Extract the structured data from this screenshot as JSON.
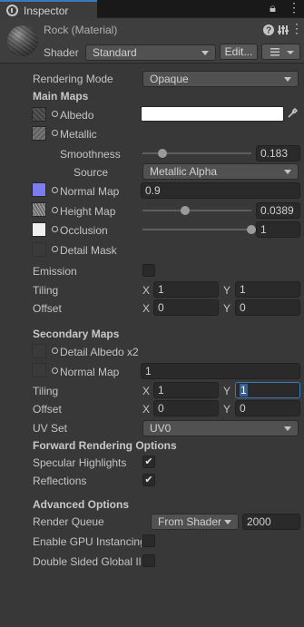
{
  "tab": {
    "title": "Inspector"
  },
  "header": {
    "material_name": "Rock (Material)",
    "shader_label": "Shader",
    "shader_value": "Standard",
    "edit_button": "Edit..."
  },
  "rendering": {
    "label": "Rendering Mode",
    "value": "Opaque"
  },
  "main_maps": {
    "heading": "Main Maps",
    "albedo_label": "Albedo",
    "albedo_color": "#ffffff",
    "metallic_label": "Metallic",
    "smoothness_label": "Smoothness",
    "smoothness_value": "0.183",
    "smoothness_level": 0.183,
    "source_label": "Source",
    "source_value": "Metallic Alpha",
    "normal_label": "Normal Map",
    "normal_value": "0.9",
    "height_label": "Height Map",
    "height_value": "0.0389",
    "height_level": 0.389,
    "occlusion_label": "Occlusion",
    "occlusion_value": "1",
    "occlusion_level": 1,
    "detail_mask_label": "Detail Mask",
    "emission_label": "Emission",
    "tiling_label": "Tiling",
    "tiling_x": "1",
    "tiling_y": "1",
    "offset_label": "Offset",
    "offset_x": "0",
    "offset_y": "0"
  },
  "secondary_maps": {
    "heading": "Secondary Maps",
    "detail_albedo_label": "Detail Albedo x2",
    "normal_label": "Normal Map",
    "normal_value": "1",
    "tiling_label": "Tiling",
    "tiling_x": "1",
    "tiling_y": "1",
    "offset_label": "Offset",
    "offset_x": "0",
    "offset_y": "0",
    "uv_set_label": "UV Set",
    "uv_set_value": "UV0"
  },
  "axis": {
    "x": "X",
    "y": "Y"
  },
  "forward": {
    "heading": "Forward Rendering Options",
    "specular_label": "Specular Highlights",
    "specular_checked": true,
    "reflections_label": "Reflections",
    "reflections_checked": true
  },
  "advanced": {
    "heading": "Advanced Options",
    "render_queue_label": "Render Queue",
    "render_queue_mode": "From Shader",
    "render_queue_value": "2000",
    "gpu_instancing_label": "Enable GPU Instancing",
    "double_sided_label": "Double Sided Global Illumination"
  },
  "colors": {
    "accent": "#3a79bb",
    "background": "#383838",
    "field": "#2a2a2a",
    "normal_map_thumb": "#7c7cf0"
  }
}
